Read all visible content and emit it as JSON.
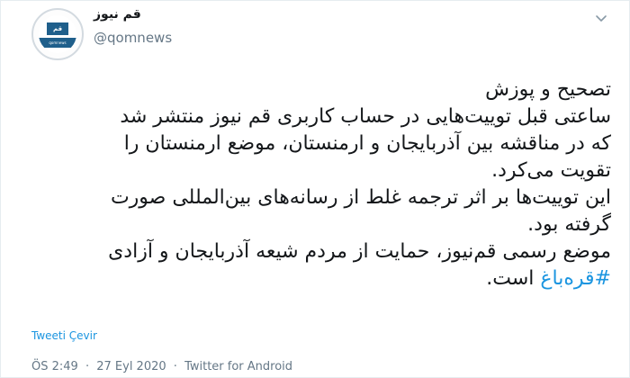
{
  "tweet": {
    "author": {
      "display_name": "قم نیوز",
      "username": "@qomnews",
      "avatar_logo_text": "قم",
      "avatar_band_text": "qomnews"
    },
    "menu_icon": "chevron-down-icon",
    "lines": [
      "تصحیح و پوزش",
      "ساعتی قبل توییت‌هایی در حساب کاربری قم نیوز منتشر شد",
      "که در مناقشه بین آذربایجان و ارمنستان، موضع ارمنستان را",
      "تقویت می‌کرد.",
      "این توییت‌ها بر اثر ترجمه غلط از رسانه‌های بین‌المللی صورت",
      "گرفته بود.",
      "موضع رسمی قم‌نیوز، حمایت از مردم شیعه آذربایجان و آزادی"
    ],
    "last_line": {
      "hashtag": "#قره‌باغ",
      "suffix": " است."
    },
    "translate_label": "Tweeti Çevir",
    "time": "ÖS 2:49",
    "date": "27 Eyl 2020",
    "source": "Twitter for Android",
    "separator": "·"
  },
  "colors": {
    "link": "#1b95e0",
    "text": "#14171a",
    "muted": "#657786",
    "brand": "#1f5f8b"
  }
}
